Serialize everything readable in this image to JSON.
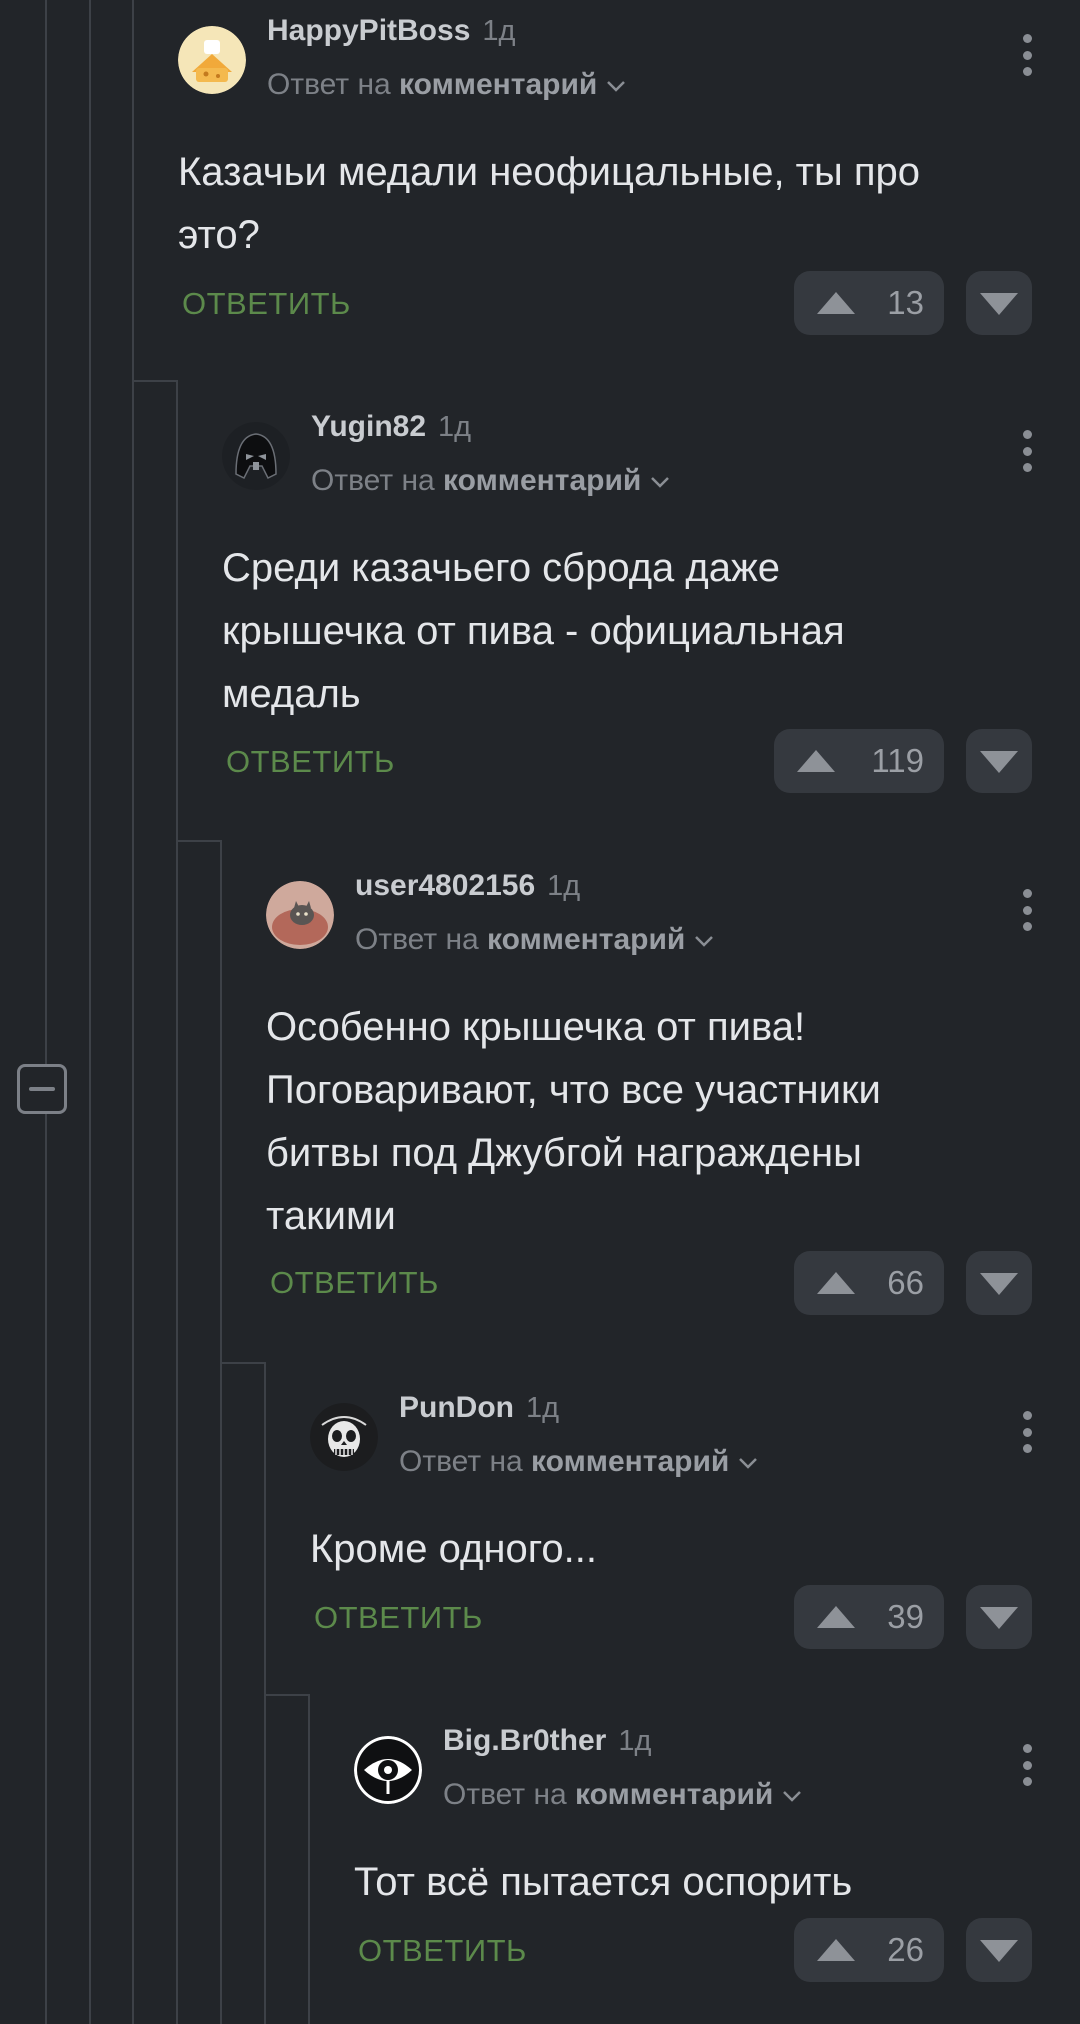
{
  "comments": [
    {
      "username": "HappyPitBoss",
      "time": "1д",
      "reply_prefix": "Ответ на",
      "reply_link": "комментарий",
      "lines": [
        "Казачьи медали неофицальные, ты про",
        "это?"
      ],
      "reply_label": "ОТВЕТИТЬ",
      "votes": "13",
      "avatar_icon": "cheese-house-avatar"
    },
    {
      "username": "Yugin82",
      "time": "1д",
      "reply_prefix": "Ответ на",
      "reply_link": "комментарий",
      "lines": [
        "Среди казачьего сброда даже",
        "крышечка от пива - официальная",
        "медаль"
      ],
      "reply_label": "ОТВЕТИТЬ",
      "votes": "119",
      "avatar_icon": "helmet-avatar"
    },
    {
      "username": "user4802156",
      "time": "1д",
      "reply_prefix": "Ответ на",
      "reply_link": "комментарий",
      "lines": [
        "Особенно крышечка от пива!",
        "Поговаривают, что все участники",
        "битвы под Джубгой награждены",
        "такими"
      ],
      "reply_label": "ОТВЕТИТЬ",
      "votes": "66",
      "avatar_icon": "cat-avatar"
    },
    {
      "username": "PunDon",
      "time": "1д",
      "reply_prefix": "Ответ на",
      "reply_link": "комментарий",
      "lines": [
        "Кроме одного..."
      ],
      "reply_label": "ОТВЕТИТЬ",
      "votes": "39",
      "avatar_icon": "skull-avatar"
    },
    {
      "username": "Big.Br0ther",
      "time": "1д",
      "reply_prefix": "Ответ на",
      "reply_link": "комментарий",
      "lines": [
        "Тот всё пытается оспорить"
      ],
      "reply_label": "ОТВЕТИТЬ",
      "votes": "26",
      "avatar_icon": "eye-avatar"
    }
  ],
  "colors": {
    "background": "#222529",
    "reply_green": "#5c8a4b",
    "vote_bg": "#35393f",
    "thread_line": "#3d4147"
  },
  "icons": {
    "collapse": "minus-square-icon",
    "menu": "kebab-menu-icon",
    "upvote": "triangle-up-icon",
    "downvote": "triangle-down-icon"
  }
}
